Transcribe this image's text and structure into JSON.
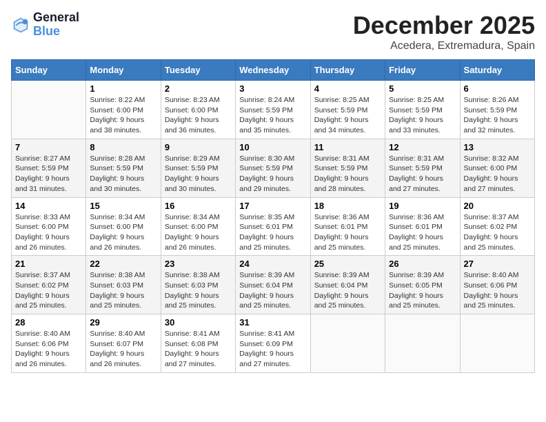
{
  "header": {
    "logo_line1": "General",
    "logo_line2": "Blue",
    "month_title": "December 2025",
    "location": "Acedera, Extremadura, Spain"
  },
  "days_of_week": [
    "Sunday",
    "Monday",
    "Tuesday",
    "Wednesday",
    "Thursday",
    "Friday",
    "Saturday"
  ],
  "weeks": [
    [
      {
        "day": "",
        "sunrise": "",
        "sunset": "",
        "daylight": ""
      },
      {
        "day": "1",
        "sunrise": "Sunrise: 8:22 AM",
        "sunset": "Sunset: 6:00 PM",
        "daylight": "Daylight: 9 hours and 38 minutes."
      },
      {
        "day": "2",
        "sunrise": "Sunrise: 8:23 AM",
        "sunset": "Sunset: 6:00 PM",
        "daylight": "Daylight: 9 hours and 36 minutes."
      },
      {
        "day": "3",
        "sunrise": "Sunrise: 8:24 AM",
        "sunset": "Sunset: 5:59 PM",
        "daylight": "Daylight: 9 hours and 35 minutes."
      },
      {
        "day": "4",
        "sunrise": "Sunrise: 8:25 AM",
        "sunset": "Sunset: 5:59 PM",
        "daylight": "Daylight: 9 hours and 34 minutes."
      },
      {
        "day": "5",
        "sunrise": "Sunrise: 8:25 AM",
        "sunset": "Sunset: 5:59 PM",
        "daylight": "Daylight: 9 hours and 33 minutes."
      },
      {
        "day": "6",
        "sunrise": "Sunrise: 8:26 AM",
        "sunset": "Sunset: 5:59 PM",
        "daylight": "Daylight: 9 hours and 32 minutes."
      }
    ],
    [
      {
        "day": "7",
        "sunrise": "Sunrise: 8:27 AM",
        "sunset": "Sunset: 5:59 PM",
        "daylight": "Daylight: 9 hours and 31 minutes."
      },
      {
        "day": "8",
        "sunrise": "Sunrise: 8:28 AM",
        "sunset": "Sunset: 5:59 PM",
        "daylight": "Daylight: 9 hours and 30 minutes."
      },
      {
        "day": "9",
        "sunrise": "Sunrise: 8:29 AM",
        "sunset": "Sunset: 5:59 PM",
        "daylight": "Daylight: 9 hours and 30 minutes."
      },
      {
        "day": "10",
        "sunrise": "Sunrise: 8:30 AM",
        "sunset": "Sunset: 5:59 PM",
        "daylight": "Daylight: 9 hours and 29 minutes."
      },
      {
        "day": "11",
        "sunrise": "Sunrise: 8:31 AM",
        "sunset": "Sunset: 5:59 PM",
        "daylight": "Daylight: 9 hours and 28 minutes."
      },
      {
        "day": "12",
        "sunrise": "Sunrise: 8:31 AM",
        "sunset": "Sunset: 5:59 PM",
        "daylight": "Daylight: 9 hours and 27 minutes."
      },
      {
        "day": "13",
        "sunrise": "Sunrise: 8:32 AM",
        "sunset": "Sunset: 6:00 PM",
        "daylight": "Daylight: 9 hours and 27 minutes."
      }
    ],
    [
      {
        "day": "14",
        "sunrise": "Sunrise: 8:33 AM",
        "sunset": "Sunset: 6:00 PM",
        "daylight": "Daylight: 9 hours and 26 minutes."
      },
      {
        "day": "15",
        "sunrise": "Sunrise: 8:34 AM",
        "sunset": "Sunset: 6:00 PM",
        "daylight": "Daylight: 9 hours and 26 minutes."
      },
      {
        "day": "16",
        "sunrise": "Sunrise: 8:34 AM",
        "sunset": "Sunset: 6:00 PM",
        "daylight": "Daylight: 9 hours and 26 minutes."
      },
      {
        "day": "17",
        "sunrise": "Sunrise: 8:35 AM",
        "sunset": "Sunset: 6:01 PM",
        "daylight": "Daylight: 9 hours and 25 minutes."
      },
      {
        "day": "18",
        "sunrise": "Sunrise: 8:36 AM",
        "sunset": "Sunset: 6:01 PM",
        "daylight": "Daylight: 9 hours and 25 minutes."
      },
      {
        "day": "19",
        "sunrise": "Sunrise: 8:36 AM",
        "sunset": "Sunset: 6:01 PM",
        "daylight": "Daylight: 9 hours and 25 minutes."
      },
      {
        "day": "20",
        "sunrise": "Sunrise: 8:37 AM",
        "sunset": "Sunset: 6:02 PM",
        "daylight": "Daylight: 9 hours and 25 minutes."
      }
    ],
    [
      {
        "day": "21",
        "sunrise": "Sunrise: 8:37 AM",
        "sunset": "Sunset: 6:02 PM",
        "daylight": "Daylight: 9 hours and 25 minutes."
      },
      {
        "day": "22",
        "sunrise": "Sunrise: 8:38 AM",
        "sunset": "Sunset: 6:03 PM",
        "daylight": "Daylight: 9 hours and 25 minutes."
      },
      {
        "day": "23",
        "sunrise": "Sunrise: 8:38 AM",
        "sunset": "Sunset: 6:03 PM",
        "daylight": "Daylight: 9 hours and 25 minutes."
      },
      {
        "day": "24",
        "sunrise": "Sunrise: 8:39 AM",
        "sunset": "Sunset: 6:04 PM",
        "daylight": "Daylight: 9 hours and 25 minutes."
      },
      {
        "day": "25",
        "sunrise": "Sunrise: 8:39 AM",
        "sunset": "Sunset: 6:04 PM",
        "daylight": "Daylight: 9 hours and 25 minutes."
      },
      {
        "day": "26",
        "sunrise": "Sunrise: 8:39 AM",
        "sunset": "Sunset: 6:05 PM",
        "daylight": "Daylight: 9 hours and 25 minutes."
      },
      {
        "day": "27",
        "sunrise": "Sunrise: 8:40 AM",
        "sunset": "Sunset: 6:06 PM",
        "daylight": "Daylight: 9 hours and 25 minutes."
      }
    ],
    [
      {
        "day": "28",
        "sunrise": "Sunrise: 8:40 AM",
        "sunset": "Sunset: 6:06 PM",
        "daylight": "Daylight: 9 hours and 26 minutes."
      },
      {
        "day": "29",
        "sunrise": "Sunrise: 8:40 AM",
        "sunset": "Sunset: 6:07 PM",
        "daylight": "Daylight: 9 hours and 26 minutes."
      },
      {
        "day": "30",
        "sunrise": "Sunrise: 8:41 AM",
        "sunset": "Sunset: 6:08 PM",
        "daylight": "Daylight: 9 hours and 27 minutes."
      },
      {
        "day": "31",
        "sunrise": "Sunrise: 8:41 AM",
        "sunset": "Sunset: 6:09 PM",
        "daylight": "Daylight: 9 hours and 27 minutes."
      },
      {
        "day": "",
        "sunrise": "",
        "sunset": "",
        "daylight": ""
      },
      {
        "day": "",
        "sunrise": "",
        "sunset": "",
        "daylight": ""
      },
      {
        "day": "",
        "sunrise": "",
        "sunset": "",
        "daylight": ""
      }
    ]
  ]
}
